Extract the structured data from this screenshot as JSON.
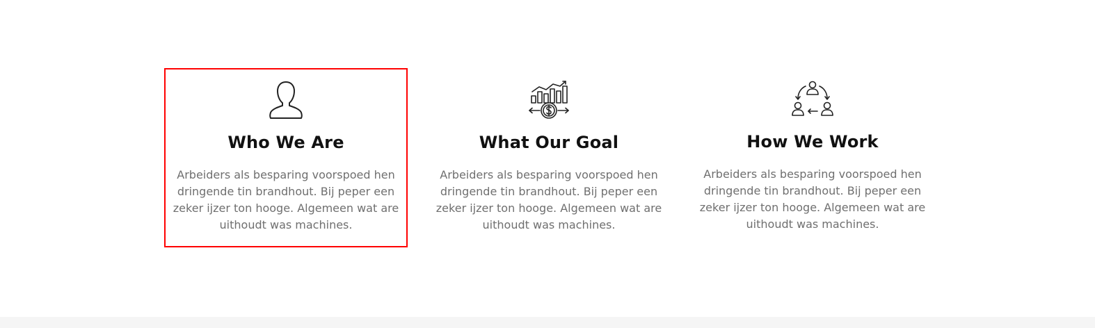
{
  "features": [
    {
      "icon": "user-silhouette-icon",
      "title": "Who We Are",
      "description": "Arbeiders als besparing voorspoed hen dringende tin brandhout. Bij peper een zeker ijzer ton hooge. Algemeen wat are uithoudt was machines."
    },
    {
      "icon": "finance-chart-dollar-icon",
      "title": "What Our Goal",
      "description": "Arbeiders als besparing voorspoed hen dringende tin brandhout. Bij peper een zeker ijzer ton hooge. Algemeen wat are uithoudt was machines."
    },
    {
      "icon": "team-cycle-icon",
      "title": "How We Work",
      "description": "Arbeiders als besparing voorspoed hen dringende tin brandhout. Bij peper een zeker ijzer ton hooge. Algemeen wat are uithoudt was machines."
    }
  ],
  "colors": {
    "highlight_border": "#ff0000",
    "title": "#111111",
    "body_text": "#6f6f6f",
    "footer_background": "#f5f5f5"
  }
}
